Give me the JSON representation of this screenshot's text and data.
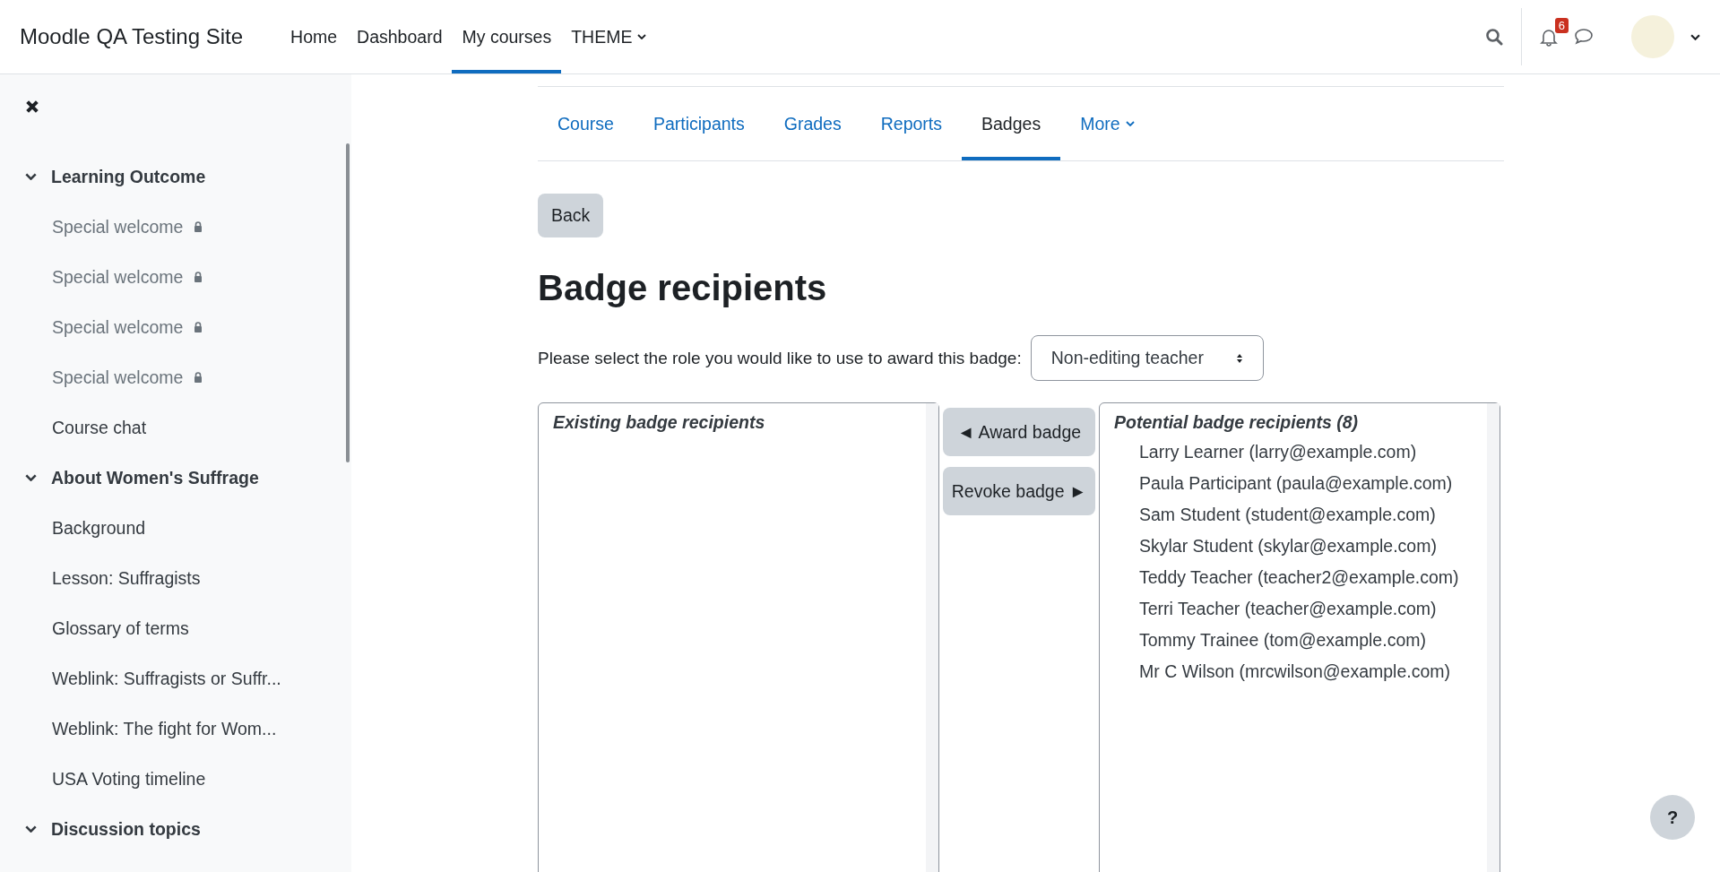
{
  "site_name": "Moodle QA Testing Site",
  "nav": [
    {
      "label": "Home",
      "selected": false,
      "dropdown": false
    },
    {
      "label": "Dashboard",
      "selected": false,
      "dropdown": false
    },
    {
      "label": "My courses",
      "selected": true,
      "dropdown": false
    },
    {
      "label": "THEME",
      "selected": false,
      "dropdown": true
    }
  ],
  "notifications": {
    "count": "6"
  },
  "sidebar": {
    "sections": [
      {
        "title": "Learning Outcome",
        "expanded": true,
        "items": [
          {
            "label": "Special welcome",
            "locked": true
          },
          {
            "label": "Special welcome",
            "locked": true
          },
          {
            "label": "Special welcome",
            "locked": true
          },
          {
            "label": "Special welcome",
            "locked": true
          },
          {
            "label": "Course chat",
            "locked": false
          }
        ]
      },
      {
        "title": "About Women's Suffrage",
        "expanded": true,
        "items": [
          {
            "label": "Background",
            "locked": false
          },
          {
            "label": "Lesson: Suffragists",
            "locked": false
          },
          {
            "label": "Glossary of terms",
            "locked": false
          },
          {
            "label": "Weblink: Suffragists or Suffr...",
            "locked": false
          },
          {
            "label": "Weblink: The fight for Wom...",
            "locked": false
          },
          {
            "label": "USA Voting timeline",
            "locked": false
          }
        ]
      },
      {
        "title": "Discussion topics",
        "expanded": true
      }
    ]
  },
  "tabs": [
    {
      "label": "Course",
      "selected": false,
      "dropdown": false
    },
    {
      "label": "Participants",
      "selected": false,
      "dropdown": false
    },
    {
      "label": "Grades",
      "selected": false,
      "dropdown": false
    },
    {
      "label": "Reports",
      "selected": false,
      "dropdown": false
    },
    {
      "label": "Badges",
      "selected": true,
      "dropdown": false
    },
    {
      "label": "More",
      "selected": false,
      "dropdown": true
    }
  ],
  "back_button": "Back",
  "page_title": "Badge recipients",
  "role_prompt": "Please select the role you would like to use to award this badge:",
  "role_select": {
    "value": "Non-editing teacher"
  },
  "existing_recipients": {
    "heading": "Existing badge recipients"
  },
  "award_button": "◄ Award badge",
  "revoke_button": "Revoke badge ►",
  "potential_recipients": {
    "heading": "Potential badge recipients (8)",
    "items": [
      "Larry Learner (larry@example.com)",
      "Paula Participant (paula@example.com)",
      "Sam Student (student@example.com)",
      "Skylar Student (skylar@example.com)",
      "Teddy Teacher (teacher2@example.com)",
      "Terri Teacher (teacher@example.com)",
      "Tommy Trainee (tom@example.com)",
      "Mr C Wilson (mrcwilson@example.com)"
    ]
  },
  "help_button": "?"
}
